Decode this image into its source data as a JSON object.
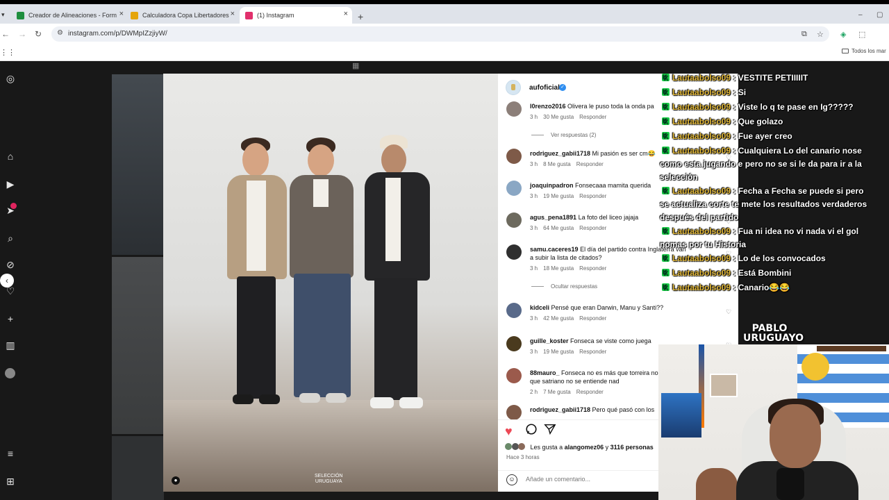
{
  "browser": {
    "tabs": [
      {
        "label": "Creador de Alineaciones - Form",
        "color": "#1e8e3e"
      },
      {
        "label": "Calculadora Copa Libertadores",
        "color": "#e5a50a"
      },
      {
        "label": "(1) Instagram",
        "color": "#e1306c"
      }
    ],
    "url": "instagram.com/p/DWMpIZzjiyW/",
    "bookmarks_folder": "Todos los mar"
  },
  "post": {
    "account": "aufoficial",
    "brand_line1": "SELECCIÓN",
    "brand_line2": "URUGUAYA",
    "likes_prefix": "Les gusta a",
    "likes_user": "alangomez06",
    "likes_mid": "y",
    "likes_count": "3116 personas",
    "posted_ago": "Hace 3 horas",
    "add_comment_placeholder": "Añade un comentario..."
  },
  "comments": [
    {
      "user": "l0renzo2016",
      "text": "Olivera le puso toda la onda pa",
      "time": "3 h",
      "likes": "30 Me gusta",
      "reply": "Responder",
      "replies_label": "Ver respuestas (2)",
      "avatar": "#8c7f79"
    },
    {
      "user": "rodriguez_gabii1718",
      "text": "Mi pasión es ser cm😂",
      "time": "3 h",
      "likes": "8 Me gusta",
      "reply": "Responder",
      "avatar": "#7e5a48"
    },
    {
      "user": "joaquinpadron",
      "text": "Fonsecaaa mamita querida",
      "time": "3 h",
      "likes": "19 Me gusta",
      "reply": "Responder",
      "avatar": "#8aa7c4"
    },
    {
      "user": "agus_pena1891",
      "text": "La foto del liceo jajaja",
      "time": "3 h",
      "likes": "64 Me gusta",
      "reply": "Responder",
      "avatar": "#6d6a5e"
    },
    {
      "user": "samu.caceres19",
      "text": "El día del partido contra Inglaterra van a subir la lista de citados?",
      "time": "3 h",
      "likes": "18 Me gusta",
      "reply": "Responder",
      "replies_label": "Ocultar respuestas",
      "avatar": "#2f2f2f"
    },
    {
      "user": "kidceli",
      "text": "Pensé que eran Darwin, Manu y Santi??",
      "time": "3 h",
      "likes": "42 Me gusta",
      "reply": "Responder",
      "avatar": "#596a8a"
    },
    {
      "user": "guille_koster",
      "text": "Fonseca se viste como juega",
      "time": "3 h",
      "likes": "19 Me gusta",
      "reply": "Responder",
      "avatar": "#4a3a1e"
    },
    {
      "user": "88mauro_",
      "text": "Fonseca no es más que torreira no es más que satriano no se entiende nad",
      "time": "2 h",
      "likes": "7 Me gusta",
      "reply": "Responder",
      "avatar": "#9b5a4c"
    },
    {
      "user": "rodriguez_gabii1718",
      "text": "Pero qué pasó con los",
      "avatar": "#7e5a48"
    }
  ],
  "chat": [
    {
      "user": "Lautaabolso09",
      "msg": "VESTITE PETIIIIIT"
    },
    {
      "user": "Lautaabolso09",
      "msg": "Si"
    },
    {
      "user": "Lautaabolso09",
      "msg": "Viste lo q te pase en Ig?????"
    },
    {
      "user": "Lautaabolso09",
      "msg": "Que golazo"
    },
    {
      "user": "Lautaabolso09",
      "msg": "Fue ayer creo"
    },
    {
      "user": "Lautaabolso09",
      "msg": "Cualquiera Lo del canario nose como esta jugando e pero no se si le da para ir a la selección"
    },
    {
      "user": "Lautaabolso09",
      "msg": "Fecha a Fecha se puede si pero se actualiza corte te mete los resultados verdaderos después del partido"
    },
    {
      "user": "Lautaabolso09",
      "msg": "Fua ni idea no vi nada vi el gol nomas por tu Historia"
    },
    {
      "user": "Lautaabolso09",
      "msg": "Lo de los convocados"
    },
    {
      "user": "Lautaabolso09",
      "msg": "Está Bombini"
    },
    {
      "user": "Lautaabolso09",
      "msg": "Canario😂😂"
    }
  ],
  "stream": {
    "logo_line1": "PABLO",
    "logo_line2": "URUGUAYO"
  }
}
